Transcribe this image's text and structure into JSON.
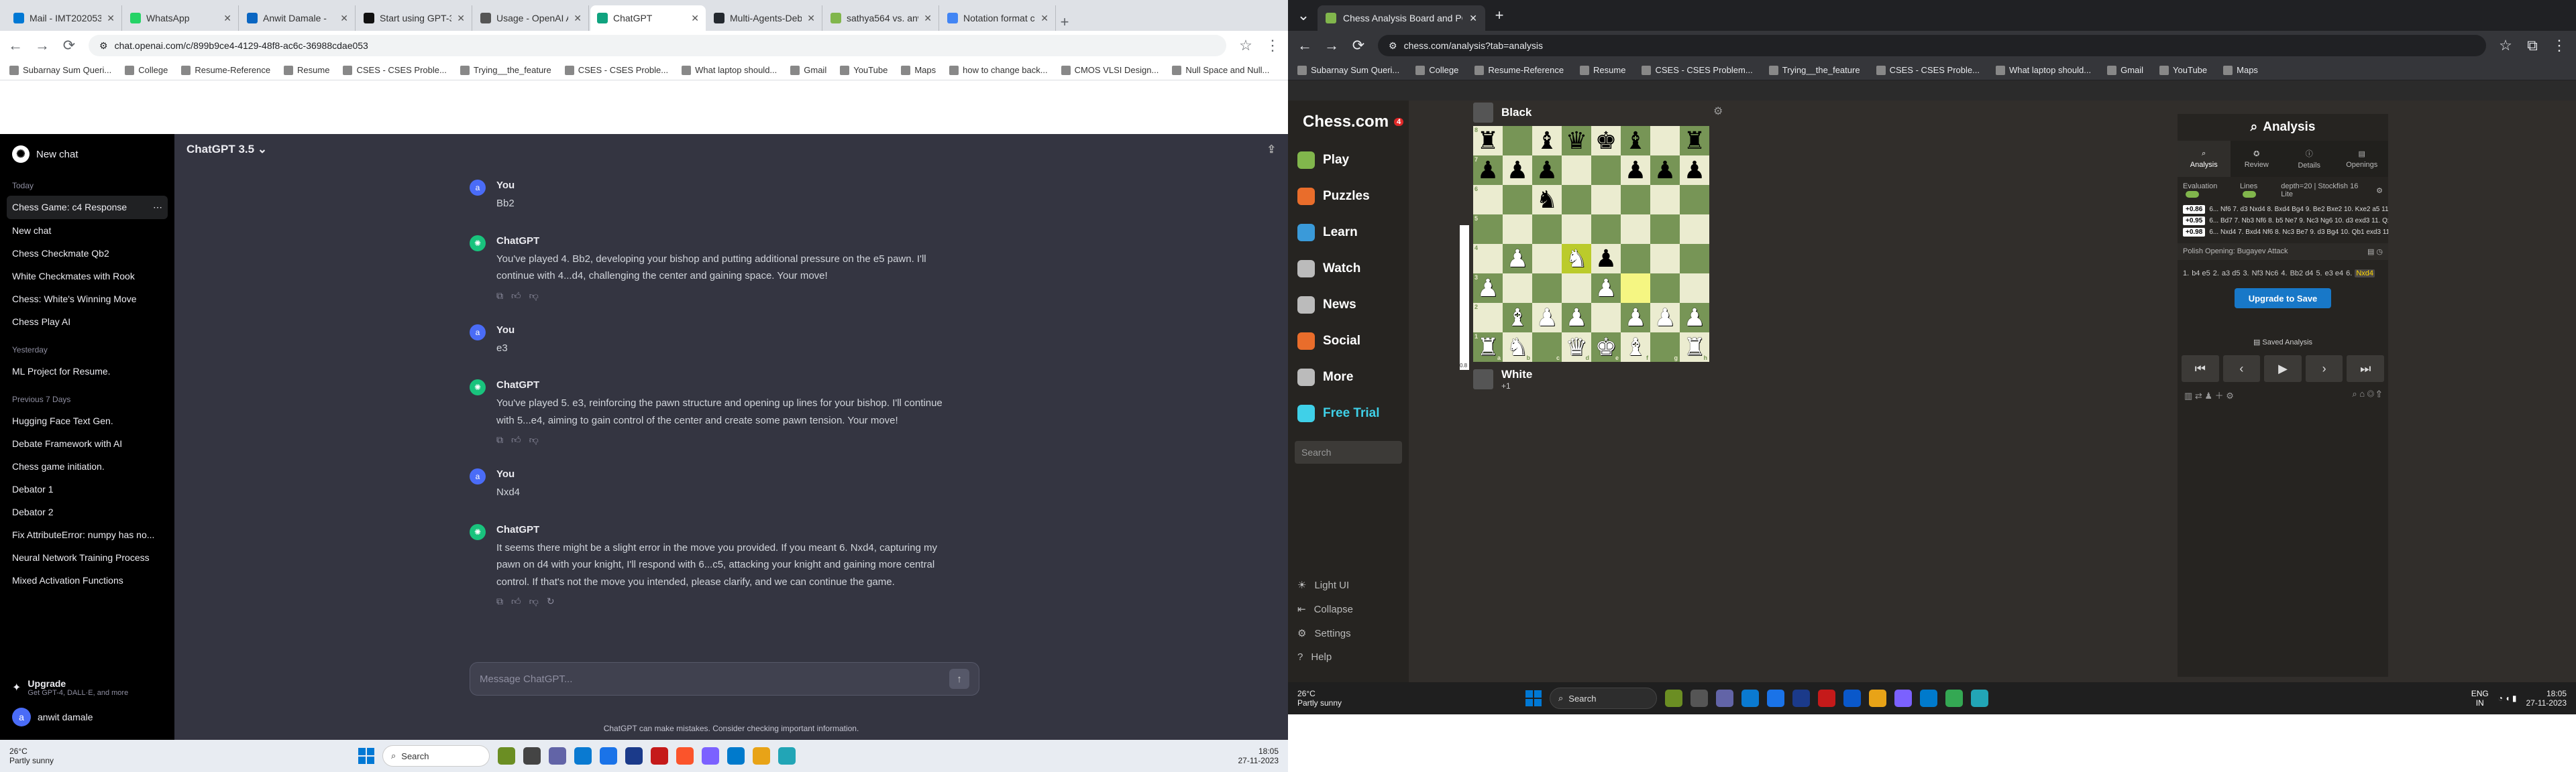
{
  "left": {
    "tabs": [
      {
        "title": "Mail - IMT2020532 ...",
        "color": "#0078d4"
      },
      {
        "title": "WhatsApp",
        "color": "#25d366"
      },
      {
        "title": "Anwit Damale -",
        "color": "#0a66c2"
      },
      {
        "title": "Start using GPT-3.5 T...",
        "color": "#111111"
      },
      {
        "title": "Usage - OpenAI API",
        "color": "#555555"
      },
      {
        "title": "ChatGPT",
        "color": "#10a37f"
      },
      {
        "title": "Multi-Agents-Debate...",
        "color": "#24292f"
      },
      {
        "title": "sathya564 vs. anwit...",
        "color": "#81b64c"
      },
      {
        "title": "Notation format che...",
        "color": "#4285f4"
      }
    ],
    "url": "chat.openai.com/c/899b9ce4-4129-48f8-ac6c-36988cdae053",
    "bookmarks": [
      "Subarnay Sum Queri...",
      "College",
      "Resume-Reference",
      "Resume",
      "CSES - CSES Proble...",
      "Trying__the_feature",
      "CSES - CSES Proble...",
      "What laptop should...",
      "Gmail",
      "YouTube",
      "Maps",
      "how to change back...",
      "CMOS VLSI Design...",
      "Null Space and Null..."
    ],
    "sidebar": {
      "new_chat": "New chat",
      "today_label": "Today",
      "today": [
        "Chess Game: c4 Response",
        "New chat",
        "Chess Checkmate Qb2",
        "White Checkmates with Rook",
        "Chess: White's Winning Move",
        "Chess Play AI"
      ],
      "yesterday_label": "Yesterday",
      "yesterday": [
        "ML Project for Resume."
      ],
      "prev7_label": "Previous 7 Days",
      "prev7": [
        "Hugging Face Text Gen.",
        "Debate Framework with AI",
        "Chess game initiation.",
        "Debator 1",
        "Debator 2",
        "Fix AttributeError: numpy has no...",
        "Neural Network Training Process",
        "Mixed Activation Functions"
      ],
      "upgrade_title": "Upgrade",
      "upgrade_sub": "Get GPT-4, DALL·E, and more",
      "user_name": "anwit damale",
      "user_initial": "a"
    },
    "chat": {
      "model": "ChatGPT 3.5",
      "messages": [
        {
          "role": "You",
          "text": "Bb2"
        },
        {
          "role": "ChatGPT",
          "text": "You've played 4. Bb2, developing your bishop and putting additional pressure on the e5 pawn. I'll continue with 4...d4, challenging the center and gaining space. Your move!"
        },
        {
          "role": "You",
          "text": "e3"
        },
        {
          "role": "ChatGPT",
          "text": "You've played 5. e3, reinforcing the pawn structure and opening up lines for your bishop. I'll continue with 5...e4, aiming to gain control of the center and create some pawn tension. Your move!"
        },
        {
          "role": "You",
          "text": "Nxd4"
        },
        {
          "role": "ChatGPT",
          "text": "It seems there might be a slight error in the move you provided. If you meant 6. Nxd4, capturing my pawn on d4 with your knight, I'll respond with 6...c5, attacking your knight and gaining more central control. If that's not the move you intended, please clarify, and we can continue the game."
        }
      ],
      "composer_placeholder": "Message ChatGPT...",
      "disclaimer": "ChatGPT can make mistakes. Consider checking important information."
    },
    "taskbar": {
      "temp": "26°C",
      "weather": "Partly sunny",
      "search": "Search",
      "time": "18:05",
      "date": "27-11-2023"
    }
  },
  "right": {
    "tab_title": "Chess Analysis Board and PGN",
    "url": "chess.com/analysis?tab=analysis",
    "bookmarks": [
      "Subarnay Sum Queri...",
      "College",
      "Resume-Reference",
      "Resume",
      "CSES - CSES Problem...",
      "Trying__the_feature",
      "CSES - CSES Proble...",
      "What laptop should...",
      "Gmail",
      "YouTube",
      "Maps"
    ],
    "nav": {
      "logo": "Chess.com",
      "badge": "4",
      "items": [
        "Play",
        "Puzzles",
        "Learn",
        "Watch",
        "News",
        "Social",
        "More",
        "Free Trial"
      ],
      "search": "Search",
      "lower": [
        "Light UI",
        "Collapse",
        "Settings",
        "Help"
      ]
    },
    "players": {
      "top": "Black",
      "bottom": "White",
      "bottom_score": "+1"
    },
    "board": {
      "ranks": [
        "8",
        "7",
        "6",
        "5",
        "4",
        "3",
        "2",
        "1"
      ],
      "files": [
        "a",
        "b",
        "c",
        "d",
        "e",
        "f",
        "g",
        "h"
      ],
      "eval": "0.8",
      "rows": [
        [
          "r",
          "",
          "b",
          "q",
          "k",
          "b",
          "",
          "r"
        ],
        [
          "p",
          "p",
          "p",
          "",
          "",
          "p",
          "p",
          "p"
        ],
        [
          "",
          "",
          "n",
          "",
          "",
          "",
          "",
          ""
        ],
        [
          "",
          "",
          "",
          "",
          "",
          "",
          "",
          ""
        ],
        [
          "",
          "P",
          "",
          "N",
          "p",
          "",
          "",
          ""
        ],
        [
          "P",
          "",
          "",
          "",
          "P",
          "",
          "",
          ""
        ],
        [
          "",
          "B",
          "P",
          "P",
          "",
          "P",
          "P",
          "P"
        ],
        [
          "R",
          "N",
          "",
          "Q",
          "K",
          "B",
          "",
          "R"
        ]
      ],
      "highlights": [
        [
          4,
          3
        ],
        [
          5,
          5
        ]
      ]
    },
    "analysis": {
      "title": "Analysis",
      "tabs": [
        "Analysis",
        "Review",
        "Details",
        "Openings"
      ],
      "evaluation_label": "Evaluation",
      "lines_label": "Lines",
      "depth": "depth=20 | Stockfish 16 Lite",
      "lines": [
        {
          "eval": "+0.86",
          "text": "6... Nf6 7. d3 Nxd4 8. Bxd4 Bg4 9. Be2 Bxe2 10. Kxe2 a5 11. dxe4 axb..."
        },
        {
          "eval": "+0.95",
          "text": "6... Bd7 7. Nb3 Nf6 8. b5 Ne7 9. Nc3 Ng6 10. d3 exd3 11. Qxd3 Bd6 1..."
        },
        {
          "eval": "+0.98",
          "text": "6... Nxd4 7. Bxd4 Nf6 8. Nc3 Be7 9. d3 Bg4 10. Qb1 exd3 11. Bxd3 a5 ..."
        }
      ],
      "opening": "Polish Opening: Bugayev Attack",
      "moves": [
        "1.",
        "b4 e5",
        "2.",
        "a3 d5",
        "3.",
        "Nf3 Nc6",
        "4.",
        "Bb2 d4",
        "5.",
        "e3 e4",
        "6."
      ],
      "current_move": "Nxd4",
      "upgrade": "Upgrade to Save",
      "saved": "Saved Analysis"
    },
    "taskbar": {
      "temp": "26°C",
      "weather": "Partly sunny",
      "search": "Search",
      "lang1": "ENG",
      "lang2": "IN",
      "time": "18:05",
      "date": "27-11-2023"
    }
  }
}
